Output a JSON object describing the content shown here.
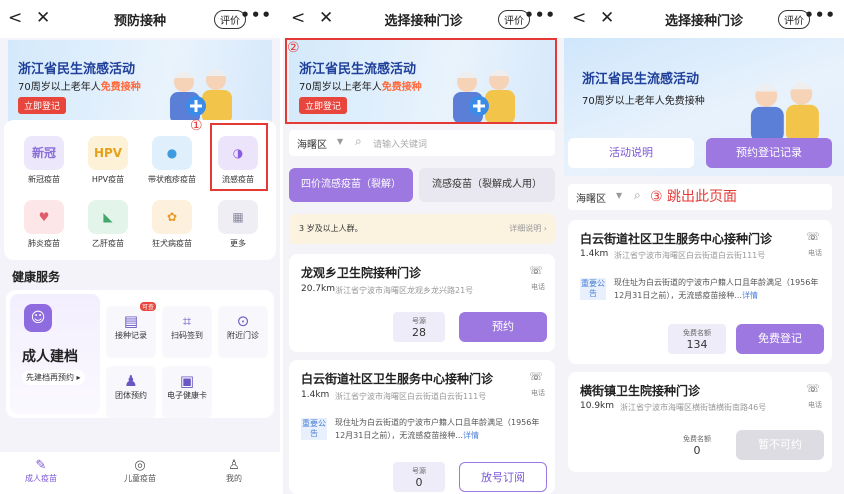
{
  "panel1": {
    "title": "预防接种",
    "eval": "评价",
    "banner": {
      "title": "浙江省民生流感活动",
      "sub_prefix": "70周岁以上老年人",
      "sub_highlight": "免费接种",
      "button": "立即登记"
    },
    "marker": "①",
    "vaccines": [
      {
        "label": "新冠疫苗",
        "icon_text": "新冠",
        "color": "#8a6fd8",
        "bg": "#ede7fb"
      },
      {
        "label": "HPV疫苗",
        "icon_text": "HPV",
        "color": "#e3a21a",
        "bg": "#fdf2d8"
      },
      {
        "label": "带状疱疹疫苗",
        "icon_text": "●",
        "color": "#3f9be0",
        "bg": "#dff0fc"
      },
      {
        "label": "流感疫苗",
        "icon_text": "◑",
        "color": "#8a5de0",
        "bg": "#ece4fb"
      },
      {
        "label": "肺炎疫苗",
        "icon_text": "♥",
        "color": "#e05c6a",
        "bg": "#fce6e8"
      },
      {
        "label": "乙肝疫苗",
        "icon_text": "◣",
        "color": "#43a66b",
        "bg": "#e3f5ea"
      },
      {
        "label": "狂犬病疫苗",
        "icon_text": "✿",
        "color": "#e89a27",
        "bg": "#fdf0dc"
      },
      {
        "label": "更多",
        "icon_text": "▦",
        "color": "#8a8aa0",
        "bg": "#eeeef4"
      }
    ],
    "health_title": "健康服务",
    "archive": {
      "title": "成人建档",
      "sub": "先建档再预约"
    },
    "services": [
      {
        "label": "接种记录",
        "badge": "可查"
      },
      {
        "label": "扫码签到"
      },
      {
        "label": "附近门诊"
      },
      {
        "label": "团体预约"
      },
      {
        "label": "电子健康卡"
      }
    ],
    "tabs": [
      {
        "label": "成人疫苗",
        "active": true
      },
      {
        "label": "儿童疫苗"
      },
      {
        "label": "我的"
      }
    ]
  },
  "panel2": {
    "title": "选择接种门诊",
    "eval": "评价",
    "marker": "②",
    "banner": {
      "title": "浙江省民生流感活动",
      "sub_prefix": "70周岁以上老年人",
      "sub_highlight": "免费接种",
      "button": "立即登记"
    },
    "district": "海曙区",
    "search_placeholder": "请输入关键词",
    "vtabs": [
      "四价流感疫苗（裂解）",
      "流感疫苗（裂解成人用）"
    ],
    "age_notice": "3 岁及以上人群。",
    "detail_link": "详细说明",
    "clinics": [
      {
        "name": "龙观乡卫生院接种门诊",
        "km": "20.7km",
        "addr": "浙江省宁波市海曙区龙观乡龙兴路21号",
        "slot_label": "号源",
        "slot_value": "28",
        "button": "预约"
      },
      {
        "name": "白云街道社区卫生服务中心接种门诊",
        "km": "1.4km",
        "addr": "浙江省宁波市海曙区白云街道白云街111号",
        "tag": "重要公告",
        "notice": "现住址为白云街道的宁波市户籍人口且年龄满足（1956年12月31日之前），无流感疫苗接种...",
        "notice_more": "详情",
        "slot_label": "号源",
        "slot_value": "0",
        "button": "放号订阅"
      }
    ],
    "phone_label": "电话"
  },
  "panel3": {
    "title": "选择接种门诊",
    "eval": "评价",
    "banner": {
      "title": "浙江省民生流感活动",
      "sub": "70周岁以上老年人免费接种"
    },
    "btn_info": "活动说明",
    "btn_record": "预约登记记录",
    "district": "海曙区",
    "jump_text": "③ 跳出此页面",
    "clinics": [
      {
        "name": "白云街道社区卫生服务中心接种门诊",
        "km": "1.4km",
        "addr": "浙江省宁波市海曙区白云街道白云街111号",
        "tag": "重要公告",
        "notice": "现住址为白云街道的宁波市户籍人口且年龄满足（1956年12月31日之前），无流感疫苗接种...",
        "notice_more": "详情",
        "slot_label": "免费名额",
        "slot_value": "134",
        "button": "免费登记"
      },
      {
        "name": "横街镇卫生院接种门诊",
        "km": "10.9km",
        "addr": "浙江省宁波市海曙区横街镇横街南路46号",
        "slot_label": "免费名额",
        "slot_value": "0",
        "button": "暂不可约"
      }
    ],
    "phone_label": "电话"
  }
}
